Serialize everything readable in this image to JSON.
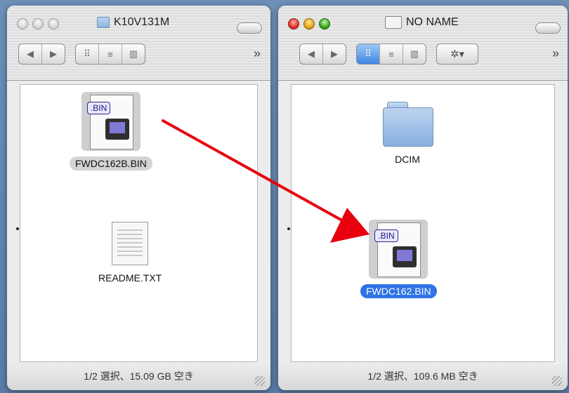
{
  "left_window": {
    "title": "K10V131M",
    "items": [
      {
        "name": "FWDC162B.BIN"
      },
      {
        "name": "README.TXT"
      }
    ],
    "status": "1/2 選択、15.09 GB 空き"
  },
  "right_window": {
    "title": "NO NAME",
    "items": [
      {
        "name": "DCIM"
      },
      {
        "name": "FWDC162.BIN"
      }
    ],
    "status": "1/2 選択、109.6 MB 空き"
  },
  "toolbar": {
    "back_glyph": "◀",
    "forward_glyph": "▶",
    "icon_view_glyph": "⠿",
    "list_view_glyph": "≡",
    "column_view_glyph": "▥",
    "action_glyph": "✲▾",
    "more_glyph": "»",
    "bin_tag": ".BIN"
  },
  "colors": {
    "selection": "#2f73e4",
    "arrow": "#e8000f"
  }
}
